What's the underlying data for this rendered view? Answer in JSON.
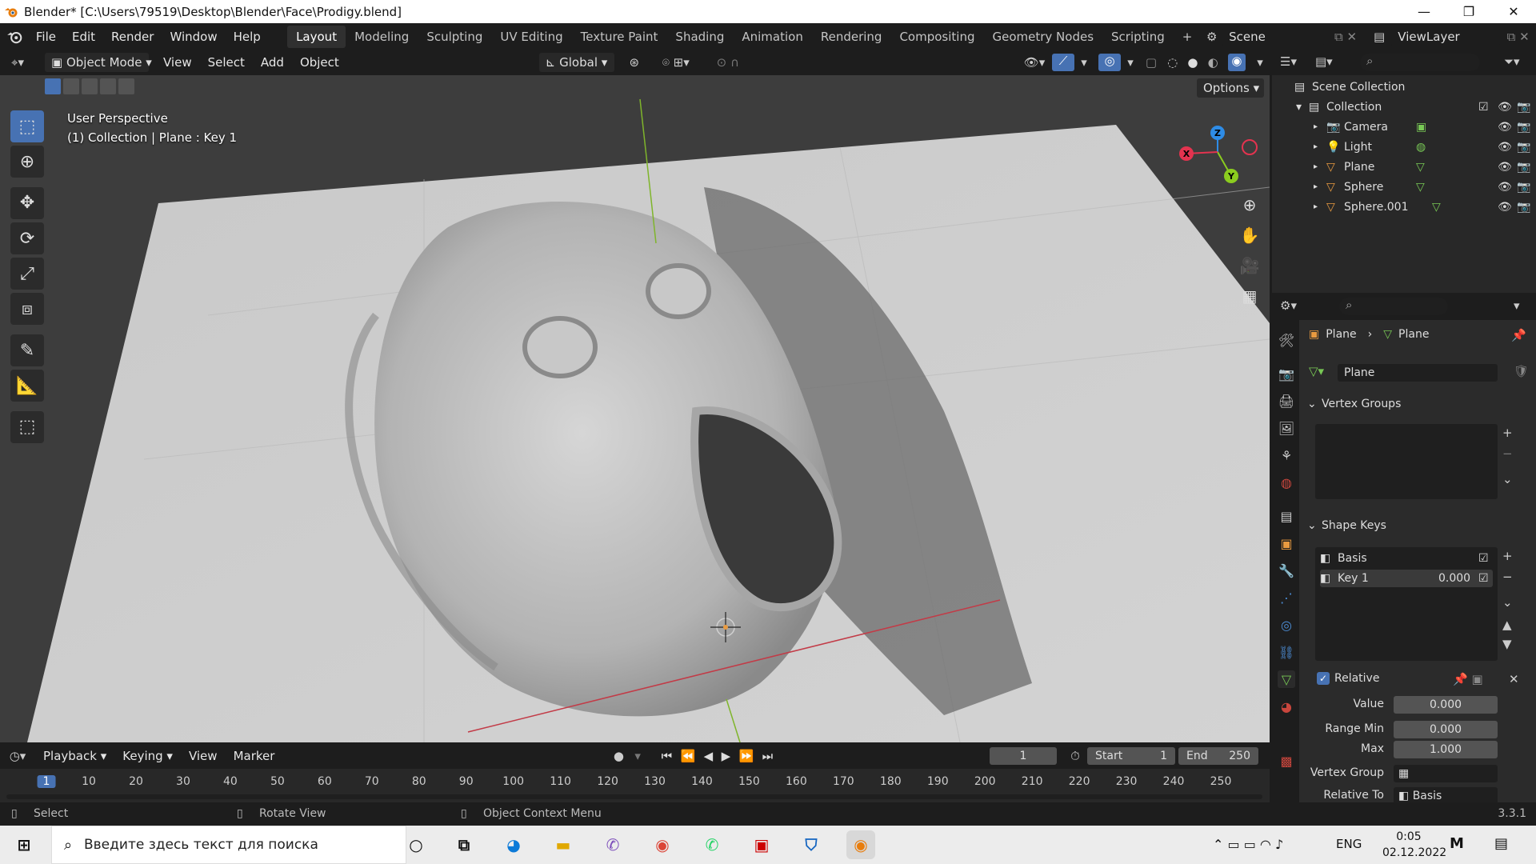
{
  "titlebar": {
    "title": "Blender* [C:\\Users\\79519\\Desktop\\Blender\\Face\\Prodigy.blend]",
    "minimize": "—",
    "restore": "❐",
    "close": "✕"
  },
  "menu": {
    "items": [
      "File",
      "Edit",
      "Render",
      "Window",
      "Help"
    ]
  },
  "workspaces": [
    "Layout",
    "Modeling",
    "Sculpting",
    "UV Editing",
    "Texture Paint",
    "Shading",
    "Animation",
    "Rendering",
    "Compositing",
    "Geometry Nodes",
    "Scripting"
  ],
  "workspace_add": "+",
  "scene": {
    "label": "Scene",
    "viewlayer": "ViewLayer"
  },
  "vp_header": {
    "mode": "Object Mode",
    "view": "View",
    "select": "Select",
    "add": "Add",
    "object": "Object",
    "orientation": "Global",
    "options": "Options"
  },
  "viewport": {
    "perspective": "User Perspective",
    "context": "(1) Collection | Plane : Key 1"
  },
  "gizmo": {
    "x": "X",
    "y": "Y",
    "z": "Z"
  },
  "outliner": {
    "root": "Scene Collection",
    "collection": "Collection",
    "items": [
      "Camera",
      "Light",
      "Plane",
      "Sphere",
      "Sphere.001"
    ]
  },
  "props": {
    "breadcrumb_object": "Plane",
    "breadcrumb_data": "Plane",
    "mesh_name": "Plane",
    "vertex_groups": "Vertex Groups",
    "shape_keys": "Shape Keys",
    "keys": [
      {
        "name": "Basis",
        "value": ""
      },
      {
        "name": "Key 1",
        "value": "0.000"
      }
    ],
    "relative": "Relative",
    "value_label": "Value",
    "value": "0.000",
    "range_min_label": "Range Min",
    "range_min": "0.000",
    "max_label": "Max",
    "max": "1.000",
    "vertex_group_label": "Vertex Group",
    "relative_to_label": "Relative To",
    "relative_to": "Basis"
  },
  "timeline": {
    "playback": "Playback",
    "keying": "Keying",
    "view": "View",
    "marker": "Marker",
    "current_frame": "1",
    "start_label": "Start",
    "start": "1",
    "end_label": "End",
    "end": "250",
    "ticks": [
      "1",
      "10",
      "20",
      "30",
      "40",
      "50",
      "60",
      "70",
      "80",
      "90",
      "100",
      "110",
      "120",
      "130",
      "140",
      "150",
      "160",
      "170",
      "180",
      "190",
      "200",
      "210",
      "220",
      "230",
      "240",
      "250"
    ]
  },
  "status": {
    "select": "Select",
    "rotate": "Rotate View",
    "context_menu": "Object Context Menu",
    "version": "3.3.1"
  },
  "taskbar": {
    "search_placeholder": "Введите здесь текст для поиска",
    "lang": "ENG",
    "time": "0:05",
    "date": "02.12.2022"
  },
  "colors": {
    "accent": "#4772b3",
    "x_axis": "#e3334f",
    "y_axis": "#8bcc1f",
    "z_axis": "#2e8ce6",
    "active_frame": "#4772b3",
    "mesh_icon": "#78c855",
    "object_icon": "#e89a40"
  }
}
